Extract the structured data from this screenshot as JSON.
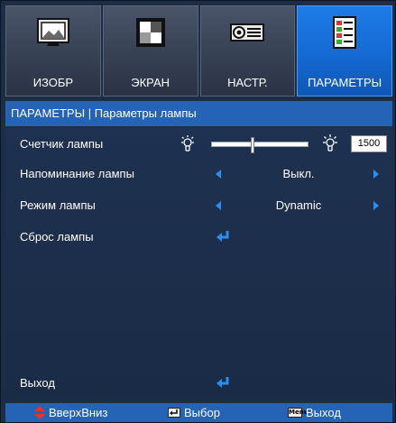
{
  "tabs": [
    {
      "label": "ИЗОБР",
      "icon": "picture-icon",
      "active": false
    },
    {
      "label": "ЭКРАН",
      "icon": "screen-icon",
      "active": false
    },
    {
      "label": "НАСТР.",
      "icon": "projector-icon",
      "active": false
    },
    {
      "label": "ПАРАМЕТРЫ",
      "icon": "options-icon",
      "active": true
    }
  ],
  "header": {
    "title": "ПАРАМЕТРЫ | Параметры лампы"
  },
  "rows": {
    "lamp_hours": {
      "label": "Счетчик лампы",
      "value": "1500",
      "slider_fraction": 0.42
    },
    "lamp_reminder": {
      "label": "Напоминание лампы",
      "value": "Выкл."
    },
    "lamp_mode": {
      "label": "Режим лампы",
      "value": "Dynamic"
    },
    "lamp_reset": {
      "label": "Сброс лампы"
    },
    "exit": {
      "label": "Выход"
    }
  },
  "footer": {
    "updown": "ВверхВниз",
    "select": "Выбор",
    "menu_key": "Menu",
    "exit": "Выход"
  },
  "colors": {
    "accent": "#2463b6",
    "arrow": "#2a8df0",
    "panel": "#1c2d45",
    "active_tab": "#1d7be8"
  }
}
